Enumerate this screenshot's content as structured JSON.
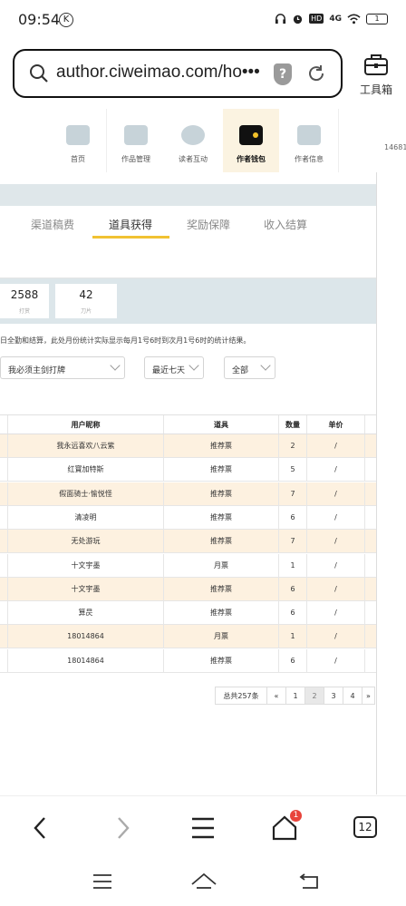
{
  "status": {
    "time": "09:54",
    "k_icon": "K",
    "hd": "HD",
    "net": "4G",
    "battery": "1"
  },
  "browser": {
    "url": "author.ciweimao.com/ho•••",
    "shield_label": "?",
    "toolbox_label": "工具箱",
    "tabs_count": "12",
    "notify_badge": "1"
  },
  "site_nav": {
    "items": [
      {
        "label": "首页",
        "icon": "home-icon"
      },
      {
        "label": "作品管理",
        "icon": "book-icon"
      },
      {
        "label": "读者互动",
        "icon": "paw-icon"
      },
      {
        "label": "作者钱包",
        "icon": "wallet-icon"
      },
      {
        "label": "作者信息",
        "icon": "id-card-icon"
      }
    ],
    "user_id_fragment": "14681"
  },
  "tabs": [
    {
      "label": "渠道稿费"
    },
    {
      "label": "道具获得"
    },
    {
      "label": "奖励保障"
    },
    {
      "label": "收入结算"
    }
  ],
  "stats": [
    {
      "value": "2588",
      "label": "打赏"
    },
    {
      "value": "42",
      "label": "刀片"
    }
  ],
  "note": "日全勤和结算，此处月份统计实际显示每月1号6时到次月1号6时的统计结果。",
  "filters": {
    "book": "我必须主剑打牌",
    "range": "最近七天",
    "type": "全部"
  },
  "table": {
    "headers": [
      "用户昵称",
      "道具",
      "数量",
      "单价"
    ],
    "rows": [
      [
        "我永远喜欢八云紫",
        "推荐票",
        "2",
        "/"
      ],
      [
        "红寶加特斯",
        "推荐票",
        "5",
        "/"
      ],
      [
        "假面骑士·愉悦怪",
        "推荐票",
        "7",
        "/"
      ],
      [
        "清凌明",
        "推荐票",
        "6",
        "/"
      ],
      [
        "无处游玩",
        "推荐票",
        "7",
        "/"
      ],
      [
        "十文宇墨",
        "月票",
        "1",
        "/"
      ],
      [
        "十文宇墨",
        "推荐票",
        "6",
        "/"
      ],
      [
        "算昃",
        "推荐票",
        "6",
        "/"
      ],
      [
        "18014864",
        "月票",
        "1",
        "/"
      ],
      [
        "18014864",
        "推荐票",
        "6",
        "/"
      ]
    ]
  },
  "pager": {
    "total": "总共257条",
    "prev": "«",
    "pages": [
      "1",
      "2",
      "3",
      "4"
    ],
    "next": "»"
  }
}
